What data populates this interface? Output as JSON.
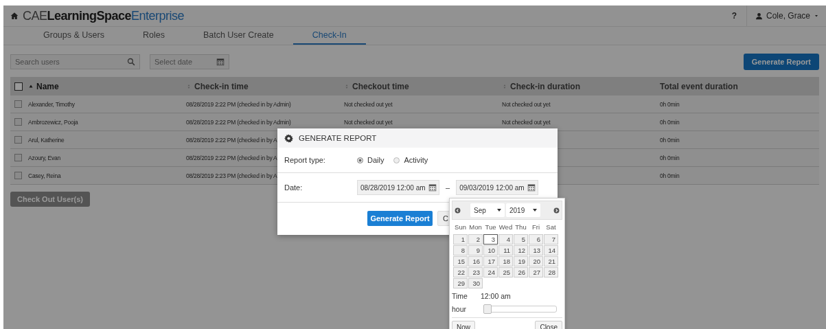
{
  "app": {
    "title_parts": [
      {
        "text": "CAE",
        "kind": "light"
      },
      {
        "text": "LearningSpace",
        "kind": "bold"
      },
      {
        "text": "Enterprise",
        "kind": "accent"
      }
    ],
    "help": "?",
    "user": "Cole, Grace"
  },
  "tabs": [
    {
      "label": "Groups & Users",
      "selected": false
    },
    {
      "label": "Roles",
      "selected": false
    },
    {
      "label": "Batch User Create",
      "selected": false
    },
    {
      "label": "Check-In",
      "selected": true
    }
  ],
  "toolbar": {
    "search": {
      "placeholder": "Search users"
    },
    "date": {
      "placeholder": "Select date"
    },
    "generate_button": "Generate Report"
  },
  "table": {
    "select_all_checked": false,
    "columns": [
      {
        "label": "Name",
        "sortable": true,
        "sorted_ascending": true
      },
      {
        "label": "Check-in time",
        "sortable": true,
        "sorted_ascending": false
      },
      {
        "label": "Checkout time",
        "sortable": true,
        "sorted_ascending": false
      },
      {
        "label": "Check-in duration",
        "sortable": true,
        "sorted_ascending": false
      },
      {
        "label": "Total event duration",
        "sortable": false,
        "sorted_ascending": false
      }
    ],
    "rows": [
      {
        "checked": false,
        "cells": [
          "Alexander, Timothy",
          "08/28/2019 2:22 PM (checked in by Admin)",
          "Not checked out yet",
          "Not checked out yet",
          "0h 0min"
        ]
      },
      {
        "checked": false,
        "cells": [
          "Ambrozewicz, Pooja",
          "08/28/2019 2:22 PM (checked in by Admin)",
          "Not checked out yet",
          "Not checked out yet",
          "0h 0min"
        ]
      },
      {
        "checked": false,
        "cells": [
          "Arul, Katherine",
          "08/28/2019 2:22 PM (checked in by A",
          "",
          "",
          "0h 0min"
        ]
      },
      {
        "checked": false,
        "cells": [
          "Azoury, Evan",
          "08/28/2019 2:22 PM (checked in by A",
          "",
          "",
          "0h 0min"
        ]
      },
      {
        "checked": false,
        "cells": [
          "Casey, Reina",
          "08/28/2019 2:23 PM (checked in by A",
          "",
          "",
          "0h 0min"
        ]
      }
    ]
  },
  "check_out_button": {
    "label": "Check Out User(s)",
    "disabled": true
  },
  "dialog": {
    "title": "GENERATE REPORT",
    "report_type_label": "Report type:",
    "report_types": [
      {
        "label": "Daily",
        "selected": true
      },
      {
        "label": "Activity",
        "selected": false
      }
    ],
    "date_label": "Date:",
    "date_from": "08/28/2019 12:00 am",
    "separator": "–",
    "date_to": "09/03/2019 12:00 am",
    "primary_button": "Generate Report",
    "secondary_button": "C"
  },
  "datepicker": {
    "month": "Sep",
    "year": "2019",
    "weekdays": [
      "Sun",
      "Mon",
      "Tue",
      "Wed",
      "Thu",
      "Fri",
      "Sat"
    ],
    "days": [
      {
        "label": "1",
        "selected": false
      },
      {
        "label": "2",
        "selected": false
      },
      {
        "label": "3",
        "selected": true
      },
      {
        "label": "4",
        "selected": false
      },
      {
        "label": "5",
        "selected": false
      },
      {
        "label": "6",
        "selected": false
      },
      {
        "label": "7",
        "selected": false
      },
      {
        "label": "8",
        "selected": false
      },
      {
        "label": "9",
        "selected": false
      },
      {
        "label": "10",
        "selected": false
      },
      {
        "label": "11",
        "selected": false
      },
      {
        "label": "12",
        "selected": false
      },
      {
        "label": "13",
        "selected": false
      },
      {
        "label": "14",
        "selected": false
      },
      {
        "label": "15",
        "selected": false
      },
      {
        "label": "16",
        "selected": false
      },
      {
        "label": "17",
        "selected": false
      },
      {
        "label": "18",
        "selected": false
      },
      {
        "label": "19",
        "selected": false
      },
      {
        "label": "20",
        "selected": false
      },
      {
        "label": "21",
        "selected": false
      },
      {
        "label": "22",
        "selected": false
      },
      {
        "label": "23",
        "selected": false
      },
      {
        "label": "24",
        "selected": false
      },
      {
        "label": "25",
        "selected": false
      },
      {
        "label": "26",
        "selected": false
      },
      {
        "label": "27",
        "selected": false
      },
      {
        "label": "28",
        "selected": false
      },
      {
        "label": "29",
        "selected": false
      },
      {
        "label": "30",
        "selected": false
      }
    ],
    "time_label": "Time",
    "time_value": "12:00 am",
    "hour_label": "hour",
    "hour": {
      "level": 0
    },
    "now_button": "Now",
    "close_button": "Close"
  }
}
